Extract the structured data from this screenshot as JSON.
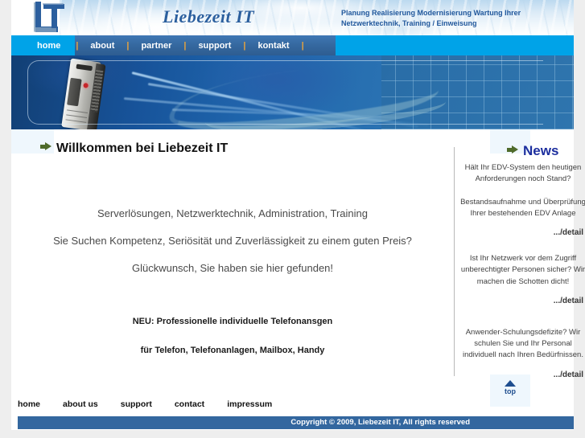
{
  "site": {
    "logo_alt": "LIT",
    "brand": "Liebezeit IT",
    "tagline_line1": "Planung Realisierung Modernisierung Wartung Ihrer",
    "tagline_line2": "Netzwerktechnik, Training / Einweisung"
  },
  "nav": {
    "items": [
      {
        "label": "home",
        "active": true
      },
      {
        "label": "about",
        "active": false
      },
      {
        "label": "partner",
        "active": false
      },
      {
        "label": "support",
        "active": false
      },
      {
        "label": "kontakt",
        "active": false
      }
    ],
    "separator": "|"
  },
  "main": {
    "page_title": "Willkommen bei Liebezeit IT",
    "lead_lines": [
      "Serverlösungen, Netzwerktechnik, Administration, Training",
      "Sie Suchen Kompetenz, Seriösität und Zuverlässigkeit zu einem guten Preis?",
      "Glückwunsch, Sie haben sie hier gefunden!"
    ],
    "promo_line1": "NEU: Professionelle individuelle Telefonansgen",
    "promo_line2": "für Telefon, Telefonanlagen, Mailbox, Handy"
  },
  "news": {
    "title": "News",
    "detail_label": ".../detail",
    "items": [
      {
        "p1": "Hält Ihr EDV-System den heutigen Anforderungen noch Stand?",
        "p2": "Bestandsaufnahme und Überprüfung Ihrer bestehenden EDV Anlage"
      },
      {
        "p1": "Ist Ihr Netzwerk vor dem Zugriff unberechtigter Personen sicher? Wir machen die Schotten dicht!",
        "p2": ""
      },
      {
        "p1": "Anwender-Schulungsdefizite? Wir schulen Sie und Ihr Personal individuell nach Ihren Bedürfnissen.",
        "p2": ""
      }
    ]
  },
  "footer": {
    "links": [
      "home",
      "about us",
      "support",
      "contact",
      "impressum"
    ],
    "top_label": "top",
    "copyright": "Copyright © 2009, Liebezeit IT, All rights reserved"
  },
  "colors": {
    "cyan": "#00a3e8",
    "nav_blue": "#35689f",
    "footer_blue": "#33679f",
    "brand_blue": "#2b5f9e",
    "news_blue": "#1c2e9e",
    "arrow_green": "#4f6b2b",
    "tint": "#eff7fd"
  }
}
